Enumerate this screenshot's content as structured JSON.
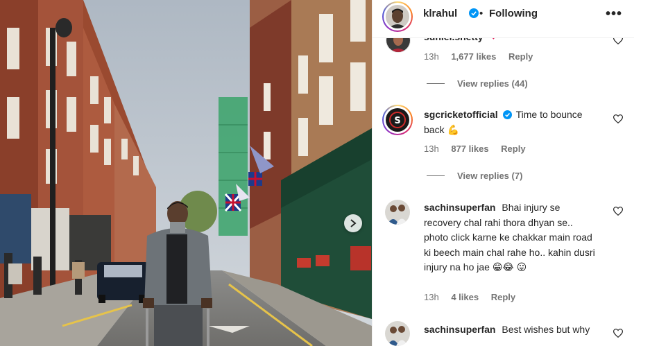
{
  "post": {
    "username": "klrahul",
    "separator": "•",
    "follow_status": "Following",
    "more_label": "•••"
  },
  "comments": [
    {
      "username": "suniel.shetty",
      "text": "❤",
      "time": "13h",
      "likes": "1,677 likes",
      "reply": "Reply",
      "view_replies": "View replies (44)"
    },
    {
      "username": "sgcricketofficial",
      "verified": true,
      "text": "Time to bounce back 💪",
      "time": "13h",
      "likes": "877 likes",
      "reply": "Reply",
      "view_replies": "View replies (7)"
    },
    {
      "username": "sachinsuperfan",
      "text": "Bhai injury se recovery chal rahi thora dhyan se.. photo click karne ke chakkar main road ki beech main chal rahe ho.. kahin dusri injury na ho jae 😁😂 😛",
      "time": "13h",
      "likes": "4 likes",
      "reply": "Reply"
    },
    {
      "username": "sachinsuperfan",
      "text": "Best wishes but why"
    }
  ],
  "colors": {
    "verified": "#0095f6",
    "secondary_text": "#737373",
    "primary_text": "#262626"
  },
  "icons": [
    "verified-badge-icon",
    "more-options-icon",
    "heart-outline-icon",
    "chevron-right-icon"
  ]
}
